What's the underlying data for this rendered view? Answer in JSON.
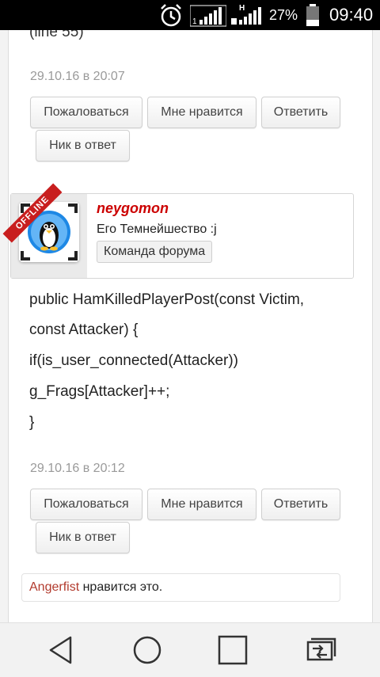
{
  "statusbar": {
    "signal_h": "H",
    "battery": "27%",
    "time": "09:40"
  },
  "post1": {
    "code_tail": "(line 55)",
    "date": "29.10.16 в 20:07",
    "buttons": {
      "report": "Пожаловаться",
      "like": "Мне нравится",
      "reply": "Ответить",
      "nick": "Ник в ответ"
    }
  },
  "post2": {
    "author": {
      "name": "neygomon",
      "title": "Его Темнейшество :j",
      "group": "Команда форума",
      "status_ribbon": "OFFLINE"
    },
    "code_lines": [
      "public HamKilledPlayerPost(const Victim,",
      "const Attacker) {",
      "if(is_user_connected(Attacker))",
      "g_Frags[Attacker]++;",
      "}"
    ],
    "date": "29.10.16 в 20:12",
    "buttons": {
      "report": "Пожаловаться",
      "like": "Мне нравится",
      "reply": "Ответить",
      "nick": "Ник в ответ"
    },
    "likes": {
      "user": "Angerfist",
      "text": " нравится это."
    }
  },
  "colors": {
    "author": "#cc0000",
    "like_user": "#b23b2e",
    "ribbon": "#c81e1e"
  },
  "navbar": {
    "icons": [
      "back-triangle-icon",
      "home-circle-icon",
      "recents-square-icon",
      "screen-switch-icon"
    ]
  }
}
